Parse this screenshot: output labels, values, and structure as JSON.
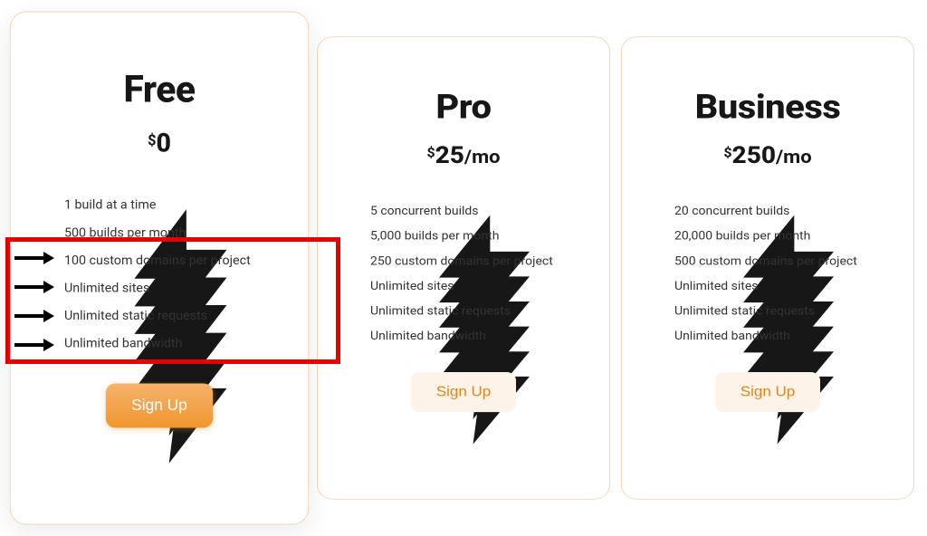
{
  "plans": {
    "free": {
      "name": "Free",
      "currency": "$",
      "amount": "0",
      "per": "",
      "cta": "Sign Up",
      "features": [
        "1 build at a time",
        "500 builds per month",
        "100 custom domains per project",
        "Unlimited sites",
        "Unlimited static requests",
        "Unlimited bandwidth"
      ]
    },
    "pro": {
      "name": "Pro",
      "currency": "$",
      "amount": "25",
      "per": "/mo",
      "cta": "Sign Up",
      "features": [
        "5 concurrent builds",
        "5,000 builds per month",
        "250 custom domains per project",
        "Unlimited sites",
        "Unlimited static requests",
        "Unlimited bandwidth"
      ]
    },
    "business": {
      "name": "Business",
      "currency": "$",
      "amount": "250",
      "per": "/mo",
      "cta": "Sign Up",
      "features": [
        "20 concurrent builds",
        "20,000 builds per month",
        "500 custom domains per project",
        "Unlimited sites",
        "Unlimited static requests",
        "Unlimited bandwidth"
      ]
    }
  },
  "annotation": {
    "highlighted_plan": "free",
    "highlighted_feature_indices": [
      2,
      3,
      4,
      5
    ]
  },
  "colors": {
    "accent": "#f0962f",
    "border": "#f3d7b8",
    "annotation": "#e60000"
  }
}
